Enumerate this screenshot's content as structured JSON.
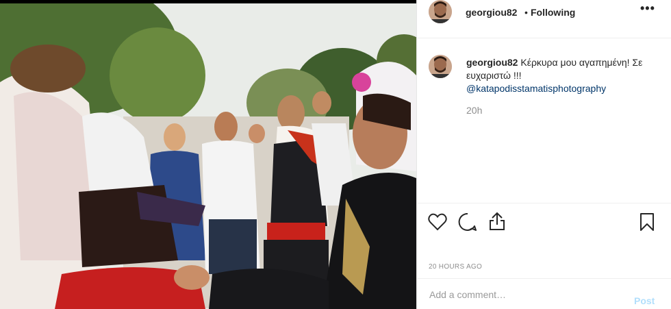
{
  "post": {
    "username": "georgiou82",
    "separator": "•",
    "follow_status": "Following",
    "more_label": "•••",
    "caption_text": "Κέρκυρα μου αγαπημένη! Σε ευχαριστώ !!!",
    "caption_mention": "@katapodisstamatisphotography",
    "relative_time": "20h",
    "posted_ago": "20 HOURS AGO"
  },
  "comment_box": {
    "placeholder": "Add a comment…",
    "post_label": "Post"
  },
  "icons": [
    "heart-icon",
    "comment-icon",
    "share-icon",
    "bookmark-icon",
    "more-icon"
  ],
  "colors": {
    "text": "#262626",
    "muted": "#8e8e8e",
    "mention": "#003569",
    "post_disabled": "#b2dffc",
    "border": "#efefef"
  }
}
